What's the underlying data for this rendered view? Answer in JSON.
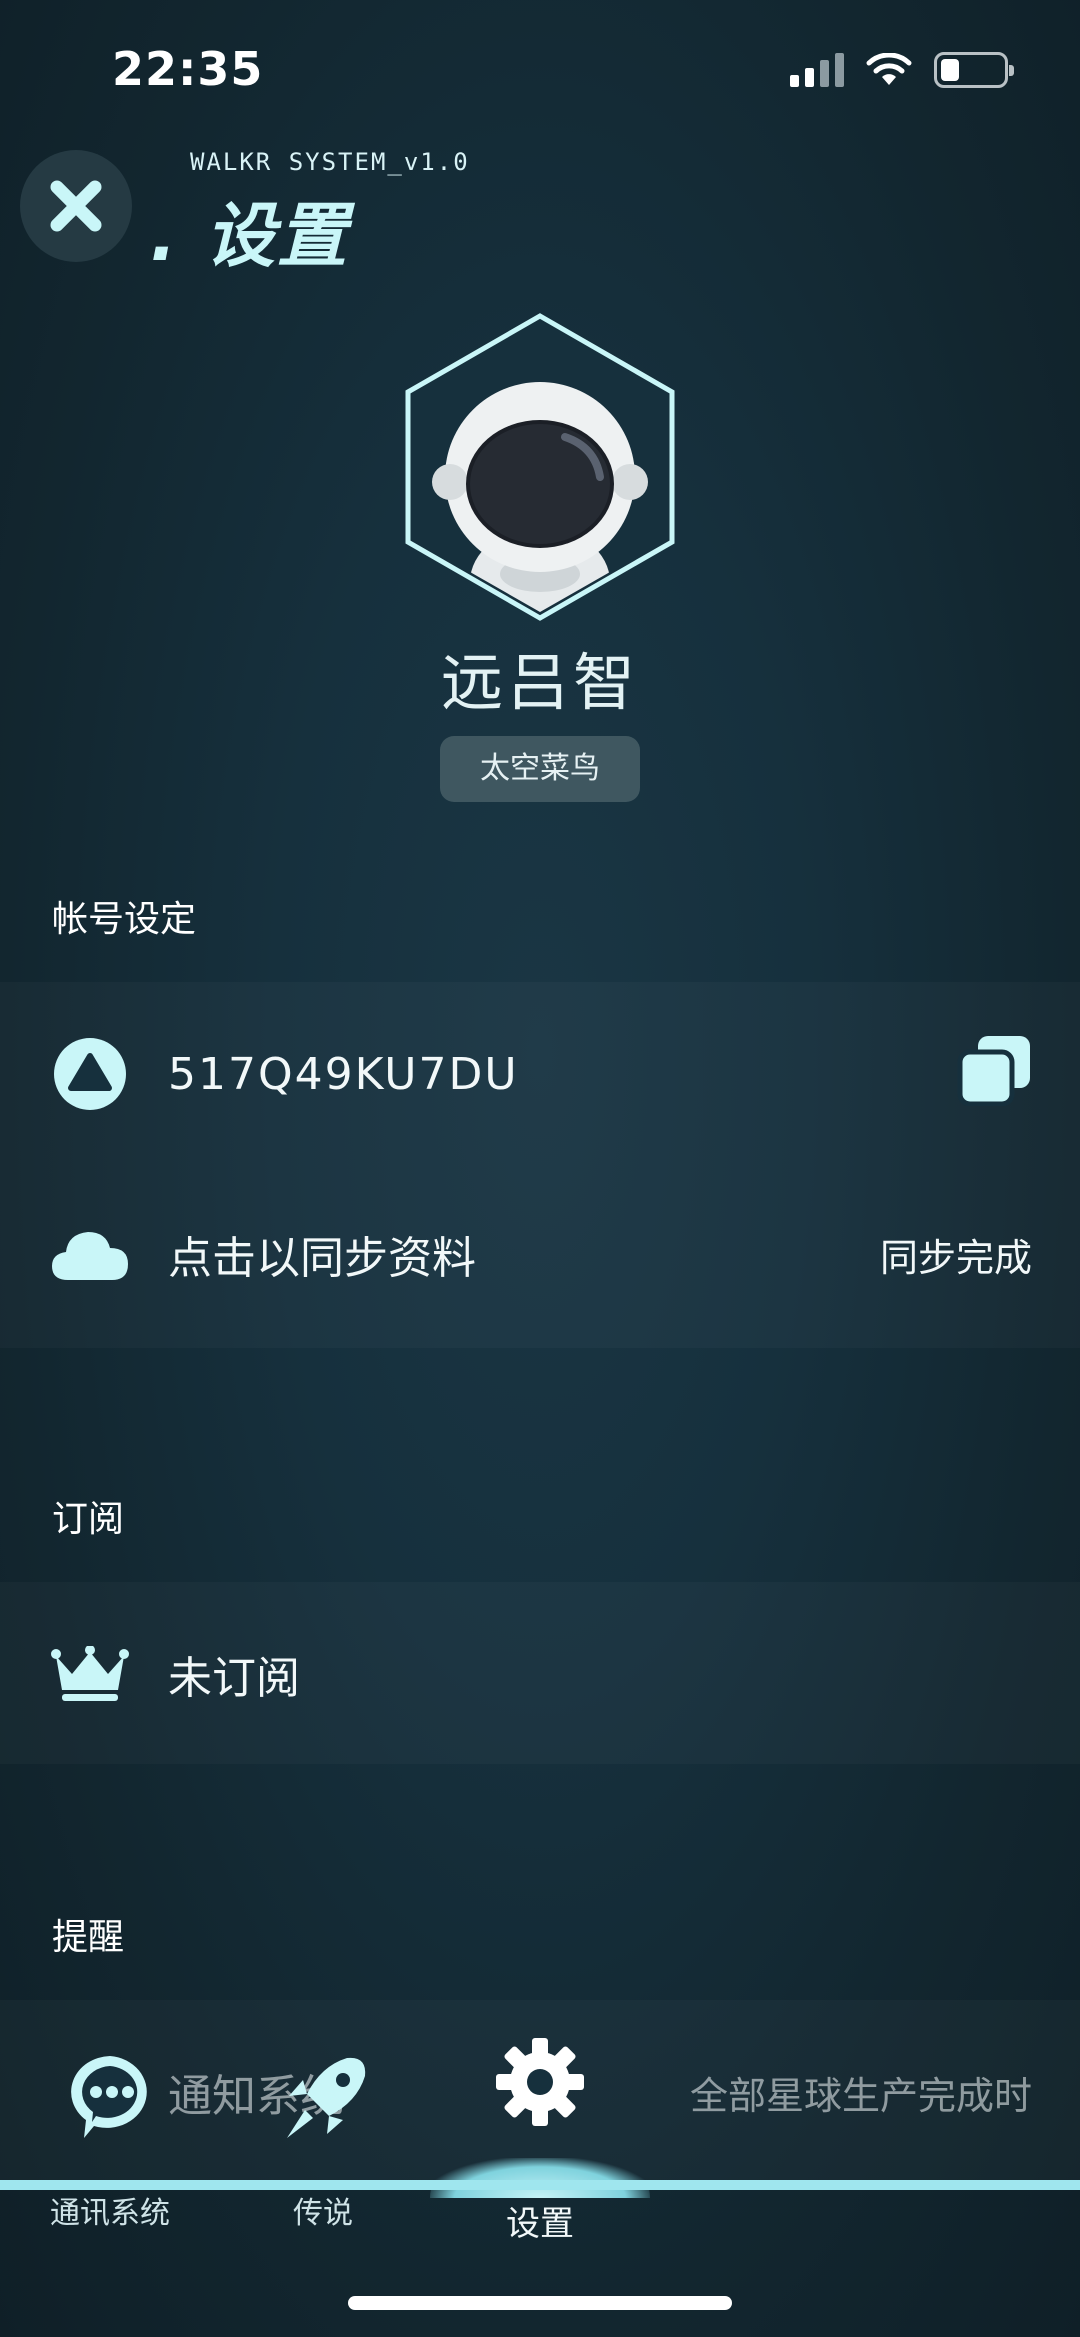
{
  "status": {
    "time": "22:35"
  },
  "header": {
    "system_label": "WALKR SYSTEM_v1.0",
    "title": ". 设置"
  },
  "profile": {
    "name": "远吕智",
    "rank": "太空菜鸟"
  },
  "account": {
    "section_title": "帐号设定",
    "id_value": "517Q49KU7DU",
    "sync_label": "点击以同步资料",
    "sync_status": "同步完成"
  },
  "subscription": {
    "section_title": "订阅",
    "status_label": "未订阅"
  },
  "reminders": {
    "section_title": "提醒",
    "notify_label": "通知系统",
    "notify_value": "全部星球生产完成时"
  },
  "tabbar": {
    "tabs": [
      {
        "label": "通讯系统",
        "icon": "chat-bubble-icon"
      },
      {
        "label": "传说",
        "icon": "rocket-icon"
      },
      {
        "label": "设置",
        "icon": "gear-icon"
      }
    ]
  },
  "colors": {
    "accent": "#9fe6ee",
    "title": "#c9f6f8",
    "background": "#16303d"
  }
}
